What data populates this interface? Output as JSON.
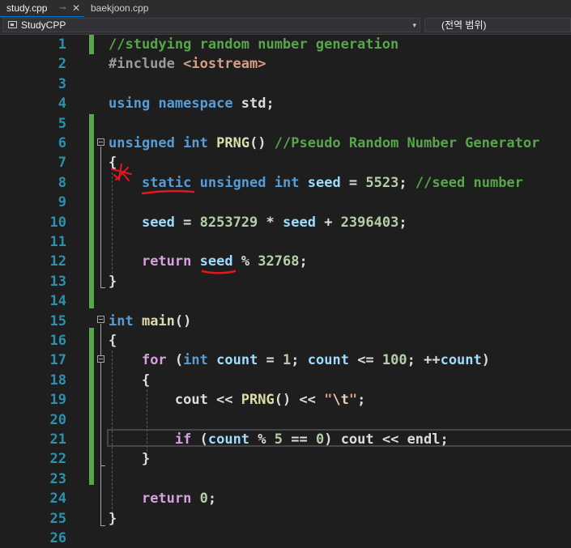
{
  "tabs": [
    {
      "label": "study.cpp",
      "pin": "⊸",
      "close": "✕",
      "active": true
    },
    {
      "label": "baekjoon.cpp",
      "active": false
    }
  ],
  "navbar": {
    "project": "StudyCPP",
    "dropdown_glyph": "▾",
    "scope": "(전역 범위)"
  },
  "editor": {
    "lines": [
      {
        "n": "1",
        "code": [
          {
            "t": "//studying random number generation",
            "c": "cmt"
          }
        ]
      },
      {
        "n": "2",
        "code": [
          {
            "t": "#include ",
            "c": "pp"
          },
          {
            "t": "<iostream>",
            "c": "str"
          }
        ]
      },
      {
        "n": "3",
        "code": []
      },
      {
        "n": "4",
        "code": [
          {
            "t": "using",
            "c": "kw"
          },
          {
            "t": " ",
            "c": "pl"
          },
          {
            "t": "namespace",
            "c": "kw"
          },
          {
            "t": " std;",
            "c": "pl"
          }
        ]
      },
      {
        "n": "5",
        "code": []
      },
      {
        "n": "6",
        "code": [
          {
            "t": "unsigned",
            "c": "kw"
          },
          {
            "t": " ",
            "c": "pl"
          },
          {
            "t": "int",
            "c": "kw"
          },
          {
            "t": " ",
            "c": "pl"
          },
          {
            "t": "PRNG",
            "c": "fn"
          },
          {
            "t": "() ",
            "c": "pl"
          },
          {
            "t": "//Pseudo Random Number Generator",
            "c": "cmt"
          }
        ]
      },
      {
        "n": "7",
        "code": [
          {
            "t": "{",
            "c": "pl"
          }
        ]
      },
      {
        "n": "8",
        "code": [
          {
            "t": "    ",
            "c": "pl"
          },
          {
            "t": "static",
            "c": "kw"
          },
          {
            "t": " ",
            "c": "pl"
          },
          {
            "t": "unsigned",
            "c": "kw"
          },
          {
            "t": " ",
            "c": "pl"
          },
          {
            "t": "int",
            "c": "kw"
          },
          {
            "t": " ",
            "c": "pl"
          },
          {
            "t": "seed",
            "c": "var"
          },
          {
            "t": " = ",
            "c": "pl"
          },
          {
            "t": "5523",
            "c": "num"
          },
          {
            "t": "; ",
            "c": "pl"
          },
          {
            "t": "//seed number",
            "c": "cmt"
          }
        ]
      },
      {
        "n": "9",
        "code": []
      },
      {
        "n": "10",
        "code": [
          {
            "t": "    ",
            "c": "pl"
          },
          {
            "t": "seed",
            "c": "var"
          },
          {
            "t": " = ",
            "c": "pl"
          },
          {
            "t": "8253729",
            "c": "num"
          },
          {
            "t": " * ",
            "c": "pl"
          },
          {
            "t": "seed",
            "c": "var"
          },
          {
            "t": " + ",
            "c": "pl"
          },
          {
            "t": "2396403",
            "c": "num"
          },
          {
            "t": ";",
            "c": "pl"
          }
        ]
      },
      {
        "n": "11",
        "code": []
      },
      {
        "n": "12",
        "code": [
          {
            "t": "    ",
            "c": "pl"
          },
          {
            "t": "return",
            "c": "ctl"
          },
          {
            "t": " ",
            "c": "pl"
          },
          {
            "t": "seed",
            "c": "var"
          },
          {
            "t": " % ",
            "c": "pl"
          },
          {
            "t": "32768",
            "c": "num"
          },
          {
            "t": ";",
            "c": "pl"
          }
        ]
      },
      {
        "n": "13",
        "code": [
          {
            "t": "}",
            "c": "pl"
          }
        ]
      },
      {
        "n": "14",
        "code": []
      },
      {
        "n": "15",
        "code": [
          {
            "t": "int",
            "c": "kw"
          },
          {
            "t": " ",
            "c": "pl"
          },
          {
            "t": "main",
            "c": "fn"
          },
          {
            "t": "()",
            "c": "pl"
          }
        ]
      },
      {
        "n": "16",
        "code": [
          {
            "t": "{",
            "c": "pl"
          }
        ]
      },
      {
        "n": "17",
        "code": [
          {
            "t": "    ",
            "c": "pl"
          },
          {
            "t": "for",
            "c": "ctl"
          },
          {
            "t": " (",
            "c": "pl"
          },
          {
            "t": "int",
            "c": "kw"
          },
          {
            "t": " ",
            "c": "pl"
          },
          {
            "t": "count",
            "c": "var"
          },
          {
            "t": " = ",
            "c": "pl"
          },
          {
            "t": "1",
            "c": "num"
          },
          {
            "t": "; ",
            "c": "pl"
          },
          {
            "t": "count",
            "c": "var"
          },
          {
            "t": " <= ",
            "c": "pl"
          },
          {
            "t": "100",
            "c": "num"
          },
          {
            "t": "; ++",
            "c": "pl"
          },
          {
            "t": "count",
            "c": "var"
          },
          {
            "t": ")",
            "c": "pl"
          }
        ]
      },
      {
        "n": "18",
        "code": [
          {
            "t": "    {",
            "c": "pl"
          }
        ]
      },
      {
        "n": "19",
        "code": [
          {
            "t": "        cout << ",
            "c": "pl"
          },
          {
            "t": "PRNG",
            "c": "fn"
          },
          {
            "t": "() << ",
            "c": "pl"
          },
          {
            "t": "\"",
            "c": "str"
          },
          {
            "t": "\\t",
            "c": "esc"
          },
          {
            "t": "\"",
            "c": "str"
          },
          {
            "t": ";",
            "c": "pl"
          }
        ]
      },
      {
        "n": "20",
        "code": []
      },
      {
        "n": "21",
        "code": [
          {
            "t": "        ",
            "c": "pl"
          },
          {
            "t": "if",
            "c": "ctl"
          },
          {
            "t": " (",
            "c": "pl"
          },
          {
            "t": "count",
            "c": "var"
          },
          {
            "t": " % ",
            "c": "pl"
          },
          {
            "t": "5",
            "c": "num"
          },
          {
            "t": " == ",
            "c": "pl"
          },
          {
            "t": "0",
            "c": "num"
          },
          {
            "t": ") cout << endl;",
            "c": "pl"
          }
        ]
      },
      {
        "n": "22",
        "code": [
          {
            "t": "    }",
            "c": "pl"
          }
        ]
      },
      {
        "n": "23",
        "code": []
      },
      {
        "n": "24",
        "code": [
          {
            "t": "    ",
            "c": "pl"
          },
          {
            "t": "return",
            "c": "ctl"
          },
          {
            "t": " ",
            "c": "pl"
          },
          {
            "t": "0",
            "c": "num"
          },
          {
            "t": ";",
            "c": "pl"
          }
        ]
      },
      {
        "n": "25",
        "code": [
          {
            "t": "}",
            "c": "pl"
          }
        ]
      },
      {
        "n": "26",
        "code": []
      }
    ]
  },
  "colors": {
    "background": "#1e1e1e",
    "line_number": "#2b91af",
    "keyword": "#569cd6",
    "control": "#d8a0df",
    "comment": "#57a64a",
    "function": "#dcdcaa",
    "variable": "#9cdcfe",
    "number": "#b5cea8",
    "string": "#d69d85",
    "annotation_ink": "#e8141e",
    "change_bar": "#57a64a"
  },
  "annotations": [
    "red-star-line-7",
    "red-underline-static",
    "red-underline-seed"
  ]
}
